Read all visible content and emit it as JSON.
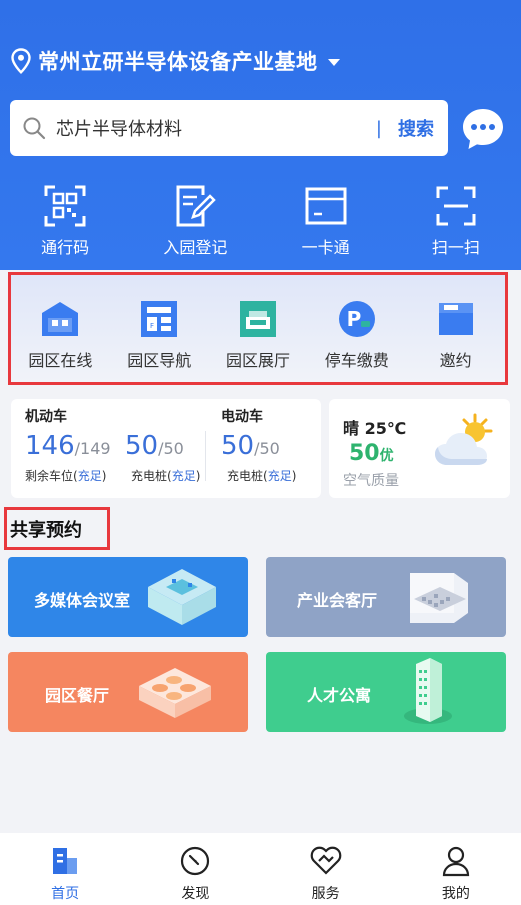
{
  "location": {
    "name": "常州立研半导体设备产业基地"
  },
  "search": {
    "query": "芯片半导体材料",
    "separator": "|",
    "button": "搜索"
  },
  "quick_actions": [
    {
      "label": "通行码",
      "icon": "qr-code-icon"
    },
    {
      "label": "入园登记",
      "icon": "register-icon"
    },
    {
      "label": "一卡通",
      "icon": "card-icon"
    },
    {
      "label": "扫一扫",
      "icon": "scan-icon"
    }
  ],
  "services": [
    {
      "label": "园区在线",
      "icon": "building-icon"
    },
    {
      "label": "园区导航",
      "icon": "map-icon"
    },
    {
      "label": "园区展厅",
      "icon": "hall-icon"
    },
    {
      "label": "停车缴费",
      "icon": "parking-icon"
    },
    {
      "label": "邀约",
      "icon": "invite-icon"
    }
  ],
  "parking": {
    "motor_title": "机动车",
    "motor_free": "146",
    "motor_total": "/149",
    "motor_free_label": "剩余车位(",
    "motor_free_status": "充足",
    "close_paren": ")",
    "motor_charge": "50",
    "motor_charge_total": "/50",
    "charge_label": "充电桩(",
    "charge_status": "充足",
    "ev_title": "电动车",
    "ev_charge": "50",
    "ev_charge_total": "/50"
  },
  "weather": {
    "condition": "晴 25℃",
    "aqi": "50",
    "aqi_level": "优",
    "aqi_label": "空气质量"
  },
  "share": {
    "title": "共享预约",
    "cards": [
      {
        "label": "多媒体会议室",
        "color": "#2f86e8"
      },
      {
        "label": "产业会客厅",
        "color": "#8fa3c6"
      },
      {
        "label": "园区餐厅",
        "color": "#f58660"
      },
      {
        "label": "人才公寓",
        "color": "#3fcd8e"
      }
    ]
  },
  "tabs": [
    {
      "label": "首页",
      "active": true
    },
    {
      "label": "发现",
      "active": false
    },
    {
      "label": "服务",
      "active": false
    },
    {
      "label": "我的",
      "active": false
    }
  ],
  "colors": {
    "primary": "#2f6fe4",
    "highlight_border": "#e8383d",
    "good": "#2eb36e"
  }
}
